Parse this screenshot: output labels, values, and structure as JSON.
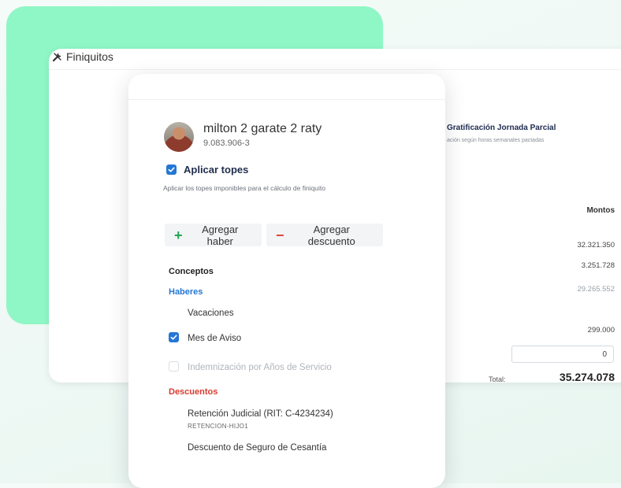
{
  "app": {
    "title": "Finiquitos"
  },
  "side_panel": {
    "gratificacion_title": "Gratificación Jornada Parcial",
    "gratificacion_desc": "ación según horas semanales pactadas",
    "montos_header": "Montos",
    "amounts": [
      "32.321.350",
      "3.251.728",
      "29.265.552",
      "299.000"
    ],
    "input_value": "0",
    "total_label": "Total:",
    "total_value": "35.274.078"
  },
  "employee": {
    "name": "milton 2 garate 2 raty",
    "rut": "9.083.906-3"
  },
  "topes": {
    "label": "Aplicar topes",
    "checked": true,
    "description": "Aplicar los topes imponibles para el cálculo de finiquito"
  },
  "actions": {
    "add_haber": "Agregar haber",
    "add_descuento": "Agregar descuento"
  },
  "conceptos": {
    "title": "Conceptos",
    "haberes_title": "Haberes",
    "haberes": [
      {
        "label": "Vacaciones",
        "checkbox": "none"
      },
      {
        "label": "Mes de Aviso",
        "checkbox": "checked"
      },
      {
        "label": "Indemnización por Años de Servicio",
        "checkbox": "disabled"
      }
    ],
    "descuentos_title": "Descuentos",
    "descuentos": [
      {
        "label": "Retención Judicial (RIT: C-4234234)",
        "sublabel": "RETENCION-HIJO1"
      },
      {
        "label": "Descuento de Seguro de Cesantía"
      }
    ]
  },
  "colors": {
    "accent_green": "#8ff7c5",
    "checkbox_blue": "#2477d4",
    "haberes_blue": "#2477d4",
    "descuentos_red": "#d63c2f",
    "add_green": "#23a453",
    "remove_red": "#e0443c"
  }
}
